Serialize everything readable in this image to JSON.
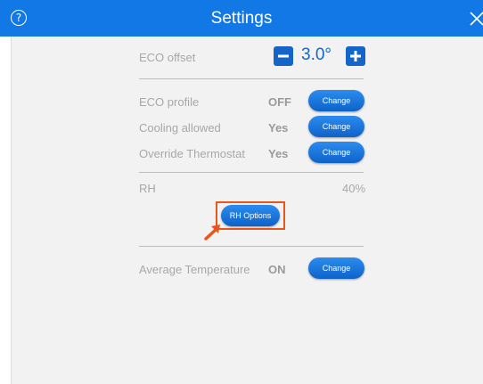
{
  "header": {
    "title": "Settings",
    "help_icon": "?",
    "accent": "#1278e6"
  },
  "eco_offset": {
    "label": "ECO offset",
    "value": "3.0°"
  },
  "rows": [
    {
      "label": "ECO profile",
      "value": "OFF",
      "button": "Change"
    },
    {
      "label": "Cooling allowed",
      "value": "Yes",
      "button": "Change"
    },
    {
      "label": "Override Thermostat",
      "value": "Yes",
      "button": "Change"
    }
  ],
  "rh": {
    "label": "RH",
    "value": "40%",
    "button": "RH Options"
  },
  "average_temperature": {
    "label": "Average Temperature",
    "value": "ON",
    "button": "Change"
  },
  "annotation": {
    "color": "#e8561c"
  }
}
